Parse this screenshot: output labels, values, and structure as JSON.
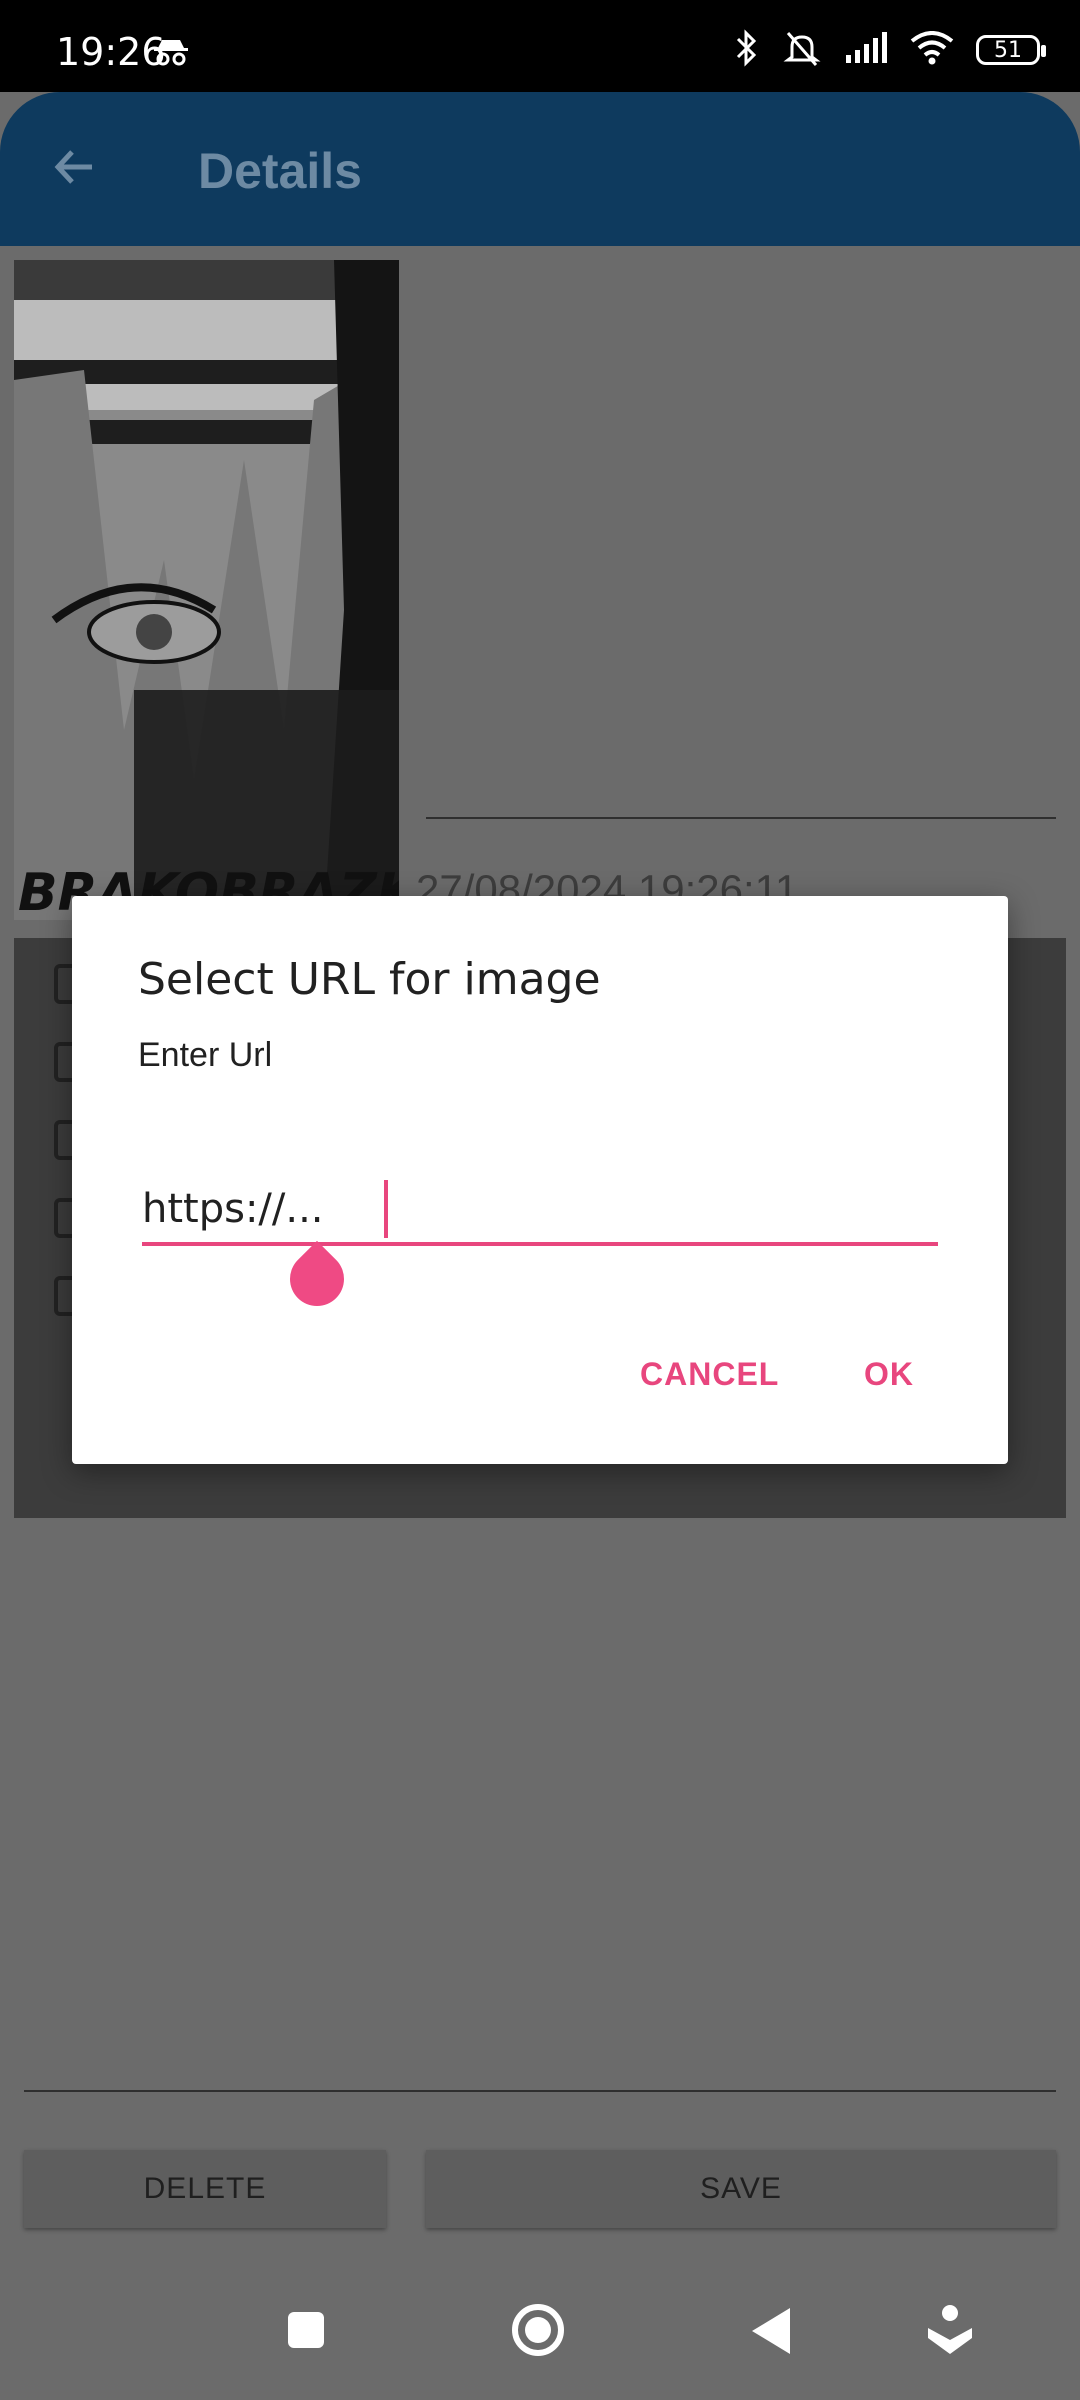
{
  "status_bar": {
    "time": "19:26",
    "battery": "51",
    "icons": [
      "incognito-icon",
      "bluetooth-icon",
      "silent-icon",
      "signal-icon",
      "wifi-icon",
      "battery-icon"
    ]
  },
  "app_bar": {
    "title": "Details",
    "back_icon": "arrow-back-icon"
  },
  "details": {
    "image_alt": "BRAKOBRAZKA",
    "date": "27/08/2024 19:26:11",
    "checkbox_count": 5
  },
  "actions": {
    "delete_label": "DELETE",
    "save_label": "SAVE"
  },
  "dialog": {
    "title": "Select URL for image",
    "message": "Enter Url",
    "input_value": "https://...",
    "cancel_label": "CANCEL",
    "ok_label": "OK"
  },
  "nav_bar": {
    "icons": [
      "recents-icon",
      "home-icon",
      "back-icon",
      "assistant-icon"
    ]
  },
  "colors": {
    "app_bar": "#0e3a5e",
    "accent": "#e8467e",
    "scrim_background": "#6b6b6b"
  }
}
